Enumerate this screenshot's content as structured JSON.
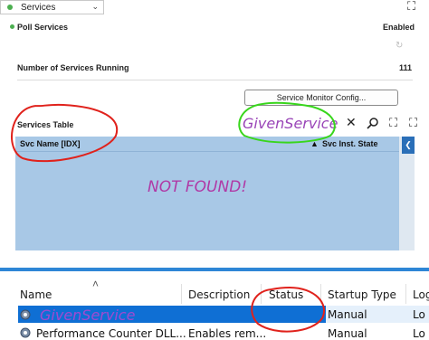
{
  "top": {
    "select_label": "Services",
    "poll_label": "Poll Services",
    "poll_value": "Enabled",
    "running_label": "Number of Services Running",
    "running_value": "111",
    "monitor_button": "Service Monitor Config...",
    "table_title": "Services Table",
    "col_name": "Svc Name [IDX]",
    "col_state": "Svc Inst. State",
    "empty_text": "NOT FOUND!",
    "search_text": "GivenService"
  },
  "bottom": {
    "columns": [
      "Name",
      "Description",
      "Status",
      "Startup Type",
      "Log"
    ],
    "rows": [
      {
        "name": "GivenService",
        "description": "",
        "status": "",
        "startup": "Manual",
        "log": "Lo"
      },
      {
        "name": "Performance Counter DLL...",
        "description": "Enables rem...",
        "status": "",
        "startup": "Manual",
        "log": "Lo"
      }
    ]
  },
  "colors": {
    "annotation_red": "#e0221c",
    "annotation_green": "#38d61c",
    "table_blue": "#a8c8e6",
    "selection_blue": "#0f6fd4"
  }
}
